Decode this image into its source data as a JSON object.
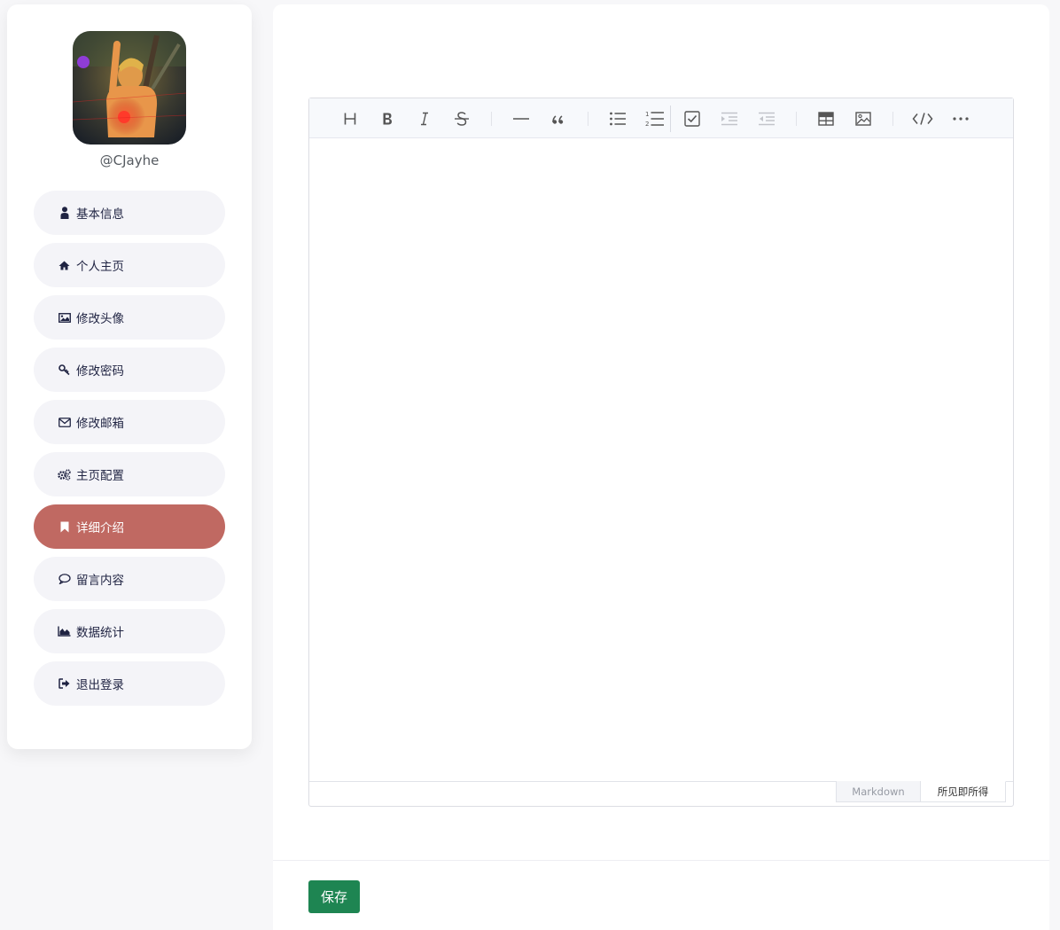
{
  "profile": {
    "username": "@CJayhe"
  },
  "menu": {
    "items": [
      {
        "label": "基本信息",
        "icon": "user-icon"
      },
      {
        "label": "个人主页",
        "icon": "home-icon"
      },
      {
        "label": "修改头像",
        "icon": "image-icon"
      },
      {
        "label": "修改密码",
        "icon": "key-icon"
      },
      {
        "label": "修改邮箱",
        "icon": "envelope-icon"
      },
      {
        "label": "主页配置",
        "icon": "cogs-icon"
      },
      {
        "label": "详细介绍",
        "icon": "bookmark-icon",
        "active": true
      },
      {
        "label": "留言内容",
        "icon": "comment-icon"
      },
      {
        "label": "数据统计",
        "icon": "area-chart-icon"
      },
      {
        "label": "退出登录",
        "icon": "sign-out-icon"
      }
    ],
    "active_color": "#c06962"
  },
  "editor": {
    "toolbar": [
      "heading-icon",
      "bold-icon",
      "italic-icon",
      "strike-icon",
      "horizontal-rule-icon",
      "quote-icon",
      "bullet-list-icon",
      "ordered-list-icon",
      "task-list-icon",
      "indent-icon",
      "outdent-icon",
      "table-icon",
      "image-icon",
      "code-icon",
      "more-icon"
    ],
    "modes": {
      "markdown": "Markdown",
      "wysiwyg": "所见即所得"
    }
  },
  "actions": {
    "save_label": "保存",
    "save_color": "#1e8552"
  }
}
